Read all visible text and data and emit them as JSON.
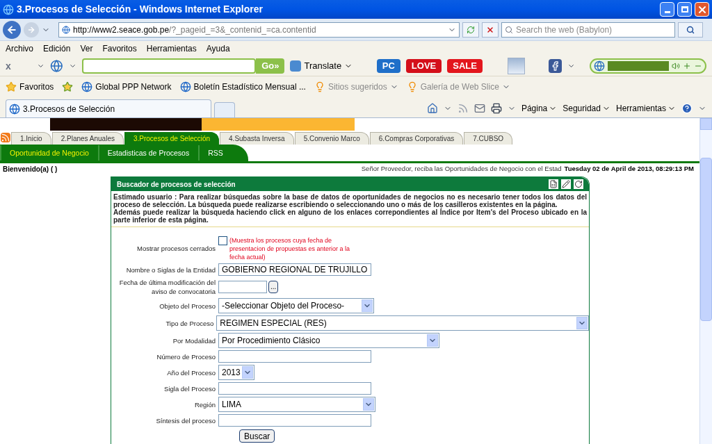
{
  "window": {
    "title": "3.Procesos de Selección - Windows Internet Explorer"
  },
  "address_bar": {
    "url_host": "http://www2.seace.gob.pe",
    "url_path": "/?_pageid_=3&_contenid_=ca.contentid",
    "search_placeholder": "Search the web (Babylon)"
  },
  "menu": [
    "Archivo",
    "Edición",
    "Ver",
    "Favoritos",
    "Herramientas",
    "Ayuda"
  ],
  "toolbar": {
    "close": "x",
    "go": "Go»",
    "translate": "Translate",
    "badges": [
      {
        "label": "PC",
        "color": "#1f6fc9"
      },
      {
        "label": "LOVE",
        "color": "#d40f1a"
      },
      {
        "label": "SALE",
        "color": "#e3161d"
      }
    ]
  },
  "favorites_bar": {
    "favorites": "Favoritos",
    "links": [
      {
        "label": "Global PPP Network",
        "disabled": false,
        "menu": false
      },
      {
        "label": "Boletín Estadístico Mensual ...",
        "disabled": false,
        "menu": false
      },
      {
        "label": "Sitios sugeridos",
        "disabled": true,
        "menu": true
      },
      {
        "label": "Galería de Web Slice",
        "disabled": true,
        "menu": true
      }
    ]
  },
  "browser_tab": {
    "title": "3.Procesos de Selección"
  },
  "command_bar": [
    "Página",
    "Seguridad",
    "Herramientas"
  ],
  "site_tabs": [
    {
      "label": "1.Inicio",
      "selected": false
    },
    {
      "label": "2.Planes Anuales",
      "selected": false
    },
    {
      "label": "3.Procesos de Selección",
      "selected": true
    },
    {
      "label": "4.Subasta Inversa",
      "selected": false
    },
    {
      "label": "5.Convenio Marco",
      "selected": false
    },
    {
      "label": "6.Compras Corporativas",
      "selected": false
    },
    {
      "label": "7.CUBSO",
      "selected": false
    }
  ],
  "subnav": [
    "Oportunidad de Negocio",
    "Estadisticas de Procesos",
    "RSS"
  ],
  "welcome": "Bienvenido(a) ( )",
  "notice": "Señor Proveedor, reciba las Oportunidades de Negocio con el Estad",
  "datetime": "Tuesday 02 de April de 2013, 08:29:13 PM",
  "panel": {
    "title": "Buscador de procesos de selección",
    "intro": [
      "Estimado usuario : Para realizar búsquedas sobre la base de datos de oportunidades de negocios no es necesario tener todos los datos del proceso de selección. La búsqueda puede realizarse escribiendo o seleccionando uno o más de los casilleros existentes en la página.",
      "Además puede realizar la búsqueda haciendo click en alguno de los enlaces correpondientes al Índice por Item's del Proceso ubicado en la parte inferior de esta página."
    ],
    "fields": [
      {
        "kind": "checkbox",
        "label": "Mostrar procesos cerrados",
        "checked": false,
        "hint": "(Muestra los procesos cuya fecha de presentacion de propuestas es anterior a la fecha actual)"
      },
      {
        "kind": "text",
        "label": "Nombre o Siglas de la Entidad",
        "value": "GOBIERNO REGIONAL DE TRUJILLO"
      },
      {
        "kind": "date",
        "label": "Fecha de última modificación del aviso de convocatoria",
        "button": "..."
      },
      {
        "kind": "select",
        "label": "Objeto del Proceso",
        "value": "-Seleccionar Objeto del Proceso-"
      },
      {
        "kind": "select",
        "label": "Tipo de Proceso",
        "value": "REGIMEN ESPECIAL (RES)"
      },
      {
        "kind": "select",
        "label": "Por Modalidad",
        "value": "Por Procedimiento Clásico"
      },
      {
        "kind": "text",
        "label": "Número de Proceso"
      },
      {
        "kind": "select",
        "label": "Año del Proceso",
        "value": "2013"
      },
      {
        "kind": "text",
        "label": "Sigla del Proceso"
      },
      {
        "kind": "select",
        "label": "Región",
        "value": "LIMA"
      },
      {
        "kind": "text",
        "label": "Síntesis del proceso"
      }
    ],
    "submit": "Buscar"
  }
}
